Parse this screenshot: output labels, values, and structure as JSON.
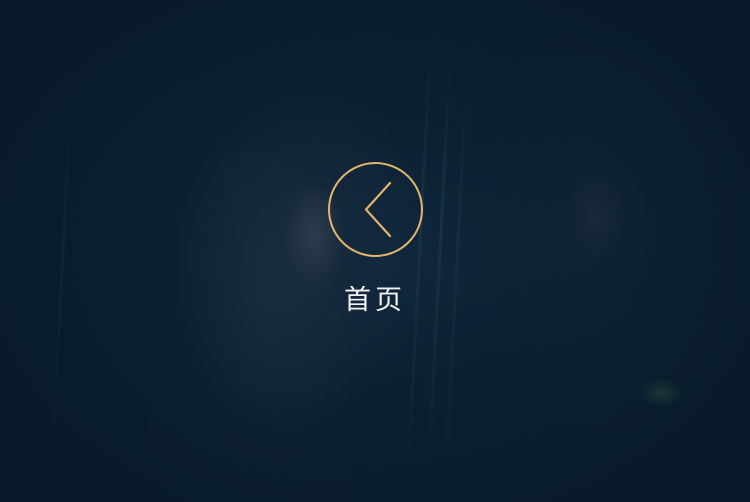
{
  "background": {
    "description_icon": "dark-movie-still",
    "tint_color": "#0d2236"
  },
  "home_button": {
    "icon": "chevron-left-icon",
    "ring_color": "#e2b56a",
    "label": "首页"
  }
}
